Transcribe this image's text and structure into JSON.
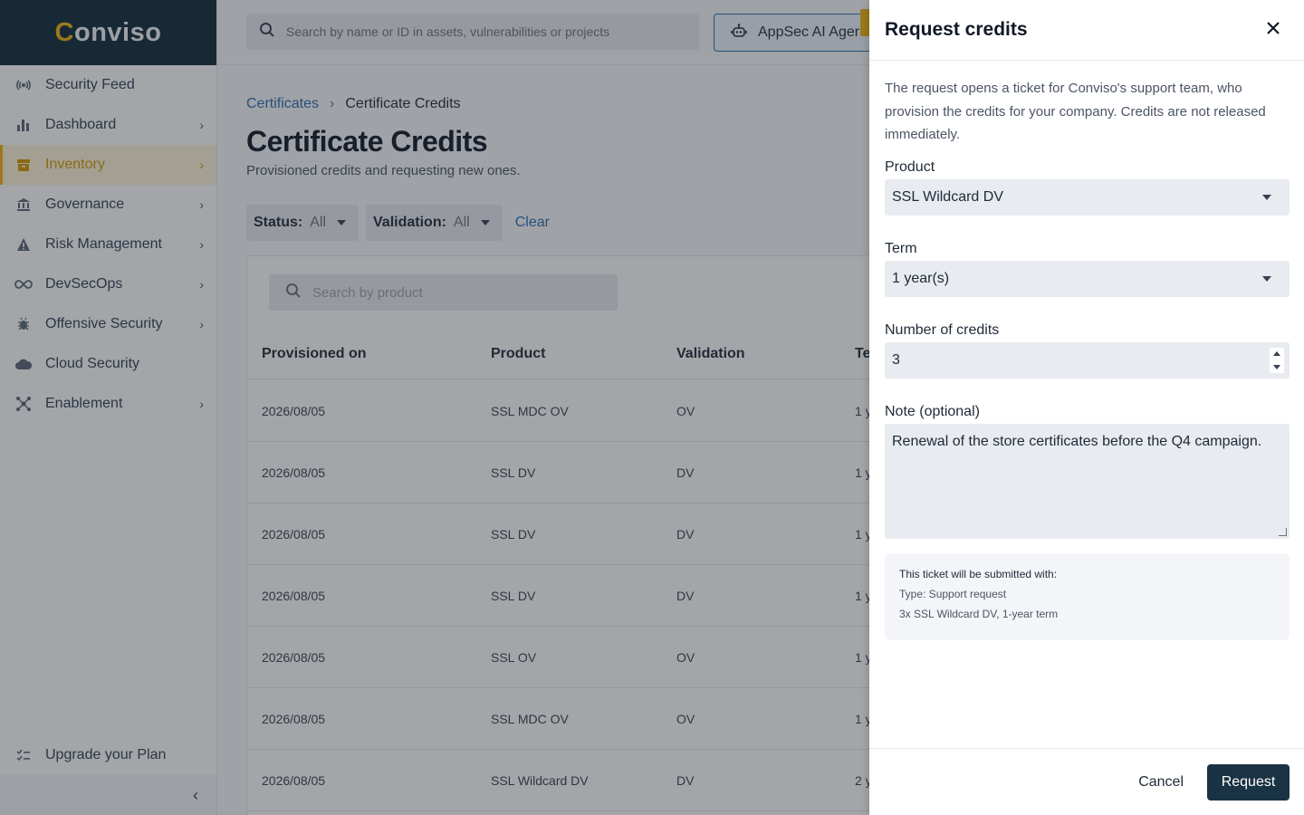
{
  "brand": {
    "name_prefix": "C",
    "name_rest": "onviso"
  },
  "sidebar": {
    "items": [
      {
        "label": "Security Feed",
        "icon": "radar-icon",
        "has_chevron": false,
        "active": false
      },
      {
        "label": "Dashboard",
        "icon": "bar-chart-icon",
        "has_chevron": true,
        "active": false
      },
      {
        "label": "Inventory",
        "icon": "archive-box-icon",
        "has_chevron": true,
        "active": true
      },
      {
        "label": "Governance",
        "icon": "bank-icon",
        "has_chevron": true,
        "active": false
      },
      {
        "label": "Risk Management",
        "icon": "warning-icon",
        "has_chevron": true,
        "active": false
      },
      {
        "label": "DevSecOps",
        "icon": "infinity-icon",
        "has_chevron": true,
        "active": false
      },
      {
        "label": "Offensive Security",
        "icon": "bug-icon",
        "has_chevron": true,
        "active": false
      },
      {
        "label": "Cloud Security",
        "icon": "cloud-icon",
        "has_chevron": false,
        "active": false
      },
      {
        "label": "Enablement",
        "icon": "network-icon",
        "has_chevron": true,
        "active": false
      }
    ],
    "upgrade_label": "Upgrade your Plan"
  },
  "topbar": {
    "search_placeholder": "Search by name or ID in assets, vulnerabilities or projects",
    "ai_button_label": "AppSec AI Ager"
  },
  "page": {
    "breadcrumb_parent": "Certificates",
    "breadcrumb_current": "Certificate Credits",
    "title": "Certificate Credits",
    "subtitle": "Provisioned credits and requesting new ones.",
    "filters": {
      "status_label": "Status:",
      "status_value": "All",
      "validation_label": "Validation:",
      "validation_value": "All",
      "clear_label": "Clear"
    },
    "table": {
      "search_placeholder": "Search by product",
      "columns": [
        "Provisioned on",
        "Product",
        "Validation",
        "Te"
      ],
      "rows": [
        {
          "provisioned": "2026/08/05",
          "product": "SSL MDC OV",
          "validation": "OV",
          "term": "1 y"
        },
        {
          "provisioned": "2026/08/05",
          "product": "SSL DV",
          "validation": "DV",
          "term": "1 y"
        },
        {
          "provisioned": "2026/08/05",
          "product": "SSL DV",
          "validation": "DV",
          "term": "1 y"
        },
        {
          "provisioned": "2026/08/05",
          "product": "SSL DV",
          "validation": "DV",
          "term": "1 y"
        },
        {
          "provisioned": "2026/08/05",
          "product": "SSL OV",
          "validation": "OV",
          "term": "1 y"
        },
        {
          "provisioned": "2026/08/05",
          "product": "SSL MDC OV",
          "validation": "OV",
          "term": "1 y"
        },
        {
          "provisioned": "2026/08/05",
          "product": "SSL Wildcard DV",
          "validation": "DV",
          "term": "2 y"
        }
      ]
    }
  },
  "drawer": {
    "title": "Request credits",
    "intro": "The request opens a ticket for Conviso's support team, who provision the credits for your company. Credits are not released immediately.",
    "product_label": "Product",
    "product_value": "SSL Wildcard DV",
    "term_label": "Term",
    "term_value": "1 year(s)",
    "credits_label": "Number of credits",
    "credits_value": "3",
    "note_label": "Note (optional)",
    "note_value": "Renewal of the store certificates before the Q4 campaign.",
    "summary_title": "This ticket will be submitted with:",
    "summary_type": "Type: Support request",
    "summary_detail": "3x SSL Wildcard DV, 1-year term",
    "cancel_label": "Cancel",
    "request_label": "Request"
  },
  "colors": {
    "brand_dark": "#0f2a3a",
    "accent": "#f2b40e",
    "link": "#2b6cb0",
    "primary_button": "#1a3344"
  }
}
